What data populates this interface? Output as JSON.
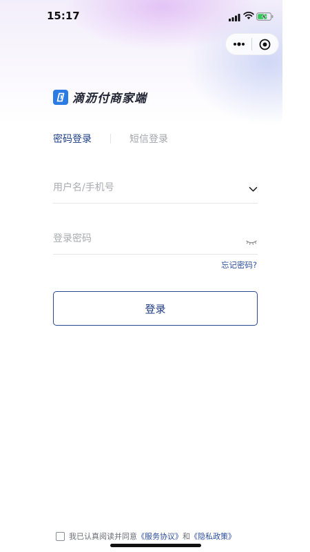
{
  "status_bar": {
    "time": "15:17"
  },
  "app": {
    "name": "滴沥付商家端"
  },
  "tabs": [
    {
      "label": "密码登录",
      "active": true
    },
    {
      "label": "短信登录",
      "active": false
    }
  ],
  "form": {
    "username": {
      "placeholder": "用户名/手机号",
      "value": ""
    },
    "password": {
      "placeholder": "登录密码",
      "value": ""
    },
    "forgot_label": "忘记密码?",
    "submit_label": "登录"
  },
  "agreement": {
    "prefix": "我已认真阅读并同意",
    "service_link": "《服务协议》",
    "conjunction": "和",
    "privacy_link": "《隐私政策》",
    "checked": false
  },
  "colors": {
    "accent": "#1d3f8a",
    "logo_blue": "#2a7be4",
    "placeholder": "#a9abb0"
  },
  "icons": [
    "signal-icon",
    "wifi-icon",
    "battery-charging-icon",
    "more-dots-icon",
    "close-target-icon",
    "chevron-down-icon",
    "eye-closed-icon",
    "logo-icon"
  ]
}
